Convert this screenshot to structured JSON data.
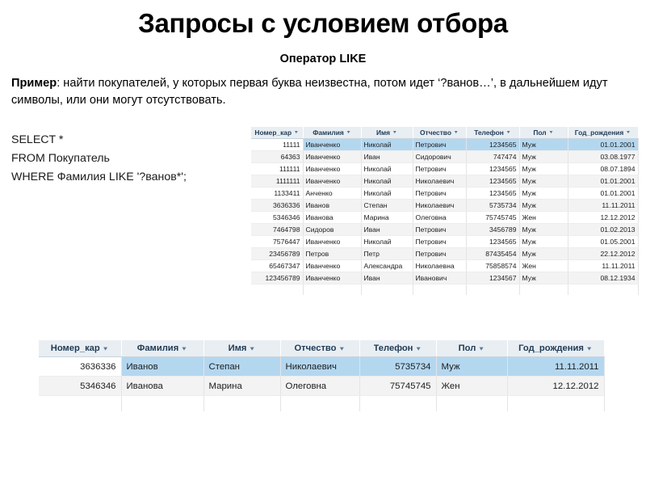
{
  "slide": {
    "title": "Запросы с условием отбора",
    "subtitle": "Оператор LIKE",
    "paragraph_lead": "Пример",
    "paragraph_rest": ": найти покупателей, у которых первая буква неизвестна, потом идет ‘?ванов…’, в дальнейшем идут символы, или они могут отсутствовать.",
    "sql": "SELECT *\nFROM Покупатель\nWHERE Фамилия LIKE '?ванов*';"
  },
  "colors": {
    "header_bg": "#e9eef3",
    "header_text": "#1f3b56",
    "selection": "#b4d7f0",
    "row_alt": "#f3f3f3",
    "grid_line": "#e4e4e4"
  },
  "grid_top": {
    "name": "Покупатель (таблица)",
    "columns": [
      {
        "label": "Номер_кар",
        "align": "num",
        "sort_icon": "chevron-down-icon"
      },
      {
        "label": "Фамилия",
        "align": "txt",
        "sort_icon": "chevron-down-icon"
      },
      {
        "label": "Имя",
        "align": "txt",
        "sort_icon": "chevron-down-icon"
      },
      {
        "label": "Отчество",
        "align": "txt",
        "sort_icon": "chevron-down-icon"
      },
      {
        "label": "Телефон",
        "align": "num",
        "sort_icon": "chevron-down-icon"
      },
      {
        "label": "Пол",
        "align": "txt",
        "sort_icon": "chevron-down-icon"
      },
      {
        "label": "Год_рождения",
        "align": "num",
        "sort_icon": "chevron-down-icon"
      }
    ],
    "rows": [
      {
        "selected": true,
        "cells": [
          "11111",
          "Иванченко",
          "Николай",
          "Петрович",
          "1234565",
          "Муж",
          "01.01.2001"
        ]
      },
      {
        "selected": false,
        "cells": [
          "64363",
          "Иванченко",
          "Иван",
          "Сидорович",
          "747474",
          "Муж",
          "03.08.1977"
        ]
      },
      {
        "selected": false,
        "cells": [
          "111111",
          "Иванченко",
          "Николай",
          "Петрович",
          "1234565",
          "Муж",
          "08.07.1894"
        ]
      },
      {
        "selected": false,
        "cells": [
          "1111111",
          "Иванченко",
          "Николай",
          "Николаевич",
          "1234565",
          "Муж",
          "01.01.2001"
        ]
      },
      {
        "selected": false,
        "cells": [
          "1133411",
          "Анченко",
          "Николай",
          "Петрович",
          "1234565",
          "Муж",
          "01.01.2001"
        ]
      },
      {
        "selected": false,
        "cells": [
          "3636336",
          "Иванов",
          "Степан",
          "Николаевич",
          "5735734",
          "Муж",
          "11.11.2011"
        ]
      },
      {
        "selected": false,
        "cells": [
          "5346346",
          "Иванова",
          "Марина",
          "Олеговна",
          "75745745",
          "Жен",
          "12.12.2012"
        ]
      },
      {
        "selected": false,
        "cells": [
          "7464798",
          "Сидоров",
          "Иван",
          "Петрович",
          "3456789",
          "Муж",
          "01.02.2013"
        ]
      },
      {
        "selected": false,
        "cells": [
          "7576447",
          "Иванченко",
          "Николай",
          "Петрович",
          "1234565",
          "Муж",
          "01.05.2001"
        ]
      },
      {
        "selected": false,
        "cells": [
          "23456789",
          "Петров",
          "Петр",
          "Петрович",
          "87435454",
          "Муж",
          "22.12.2012"
        ]
      },
      {
        "selected": false,
        "cells": [
          "65467347",
          "Иванченко",
          "Александра",
          "Николаевна",
          "75858574",
          "Жен",
          "11.11.2011"
        ]
      },
      {
        "selected": false,
        "cells": [
          "123456789",
          "Иванченко",
          "Иван",
          "Иванович",
          "1234567",
          "Муж",
          "08.12.1934"
        ]
      }
    ]
  },
  "grid_bottom": {
    "name": "Результат запроса",
    "columns": [
      {
        "label": "Номер_кар",
        "align": "num",
        "sort_icon": "chevron-down-icon"
      },
      {
        "label": "Фамилия",
        "align": "txt",
        "sort_icon": "chevron-down-icon"
      },
      {
        "label": "Имя",
        "align": "txt",
        "sort_icon": "chevron-down-icon"
      },
      {
        "label": "Отчество",
        "align": "txt",
        "sort_icon": "chevron-down-icon"
      },
      {
        "label": "Телефон",
        "align": "num",
        "sort_icon": "chevron-down-icon"
      },
      {
        "label": "Пол",
        "align": "txt",
        "sort_icon": "chevron-down-icon"
      },
      {
        "label": "Год_рождения",
        "align": "num",
        "sort_icon": "chevron-down-icon"
      }
    ],
    "rows": [
      {
        "selected": true,
        "cells": [
          "3636336",
          "Иванов",
          "Степан",
          "Николаевич",
          "5735734",
          "Муж",
          "11.11.2011"
        ]
      },
      {
        "selected": false,
        "cells": [
          "5346346",
          "Иванова",
          "Марина",
          "Олеговна",
          "75745745",
          "Жен",
          "12.12.2012"
        ]
      }
    ]
  }
}
